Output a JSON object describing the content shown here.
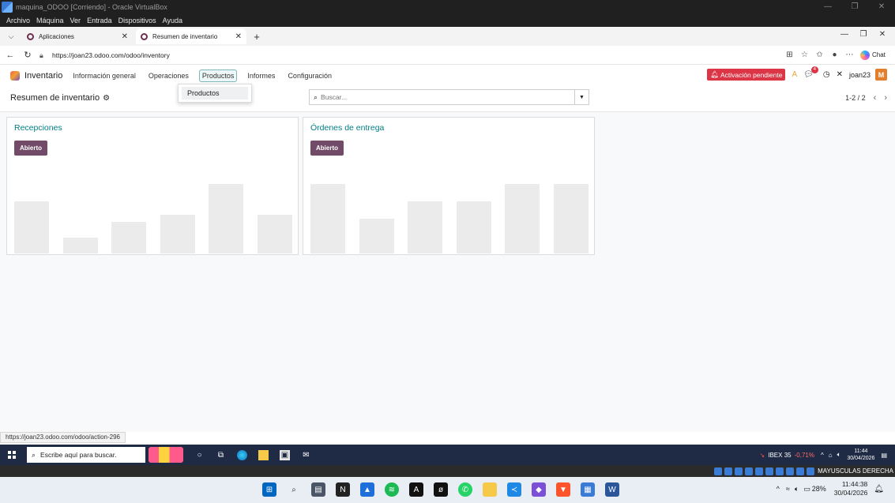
{
  "vbox": {
    "title": "maquina_ODOO [Corriendo] - Oracle VirtualBox",
    "menu": [
      "Archivo",
      "Máquina",
      "Ver",
      "Entrada",
      "Dispositivos",
      "Ayuda"
    ]
  },
  "browser": {
    "tabs": [
      {
        "label": "Aplicaciones",
        "active": false
      },
      {
        "label": "Resumen de inventario",
        "active": true
      }
    ],
    "url": "https://joan23.odoo.com/odoo/inventory",
    "chat_label": "Chat",
    "status_url": "https://joan23.odoo.com/odoo/action-296"
  },
  "odoo": {
    "app_name": "Inventario",
    "menu": [
      "Información general",
      "Operaciones",
      "Productos",
      "Informes",
      "Configuración"
    ],
    "active_menu": "Productos",
    "dropdown_items": [
      "Productos"
    ],
    "activation_badge": "Activación pendiente",
    "message_count": "4",
    "user_name": "joan23",
    "user_initial": "M",
    "breadcrumb": "Resumen de inventario",
    "search_placeholder": "Buscar...",
    "pager": "1-2 / 2"
  },
  "cards": [
    {
      "title": "Recepciones",
      "button": "Abierto",
      "bar_levels": [
        0.6,
        0.18,
        0.36,
        0.45,
        0.8,
        0.45
      ]
    },
    {
      "title": "Órdenes de entrega",
      "button": "Abierto",
      "bar_levels": [
        0.8,
        0.4,
        0.6,
        0.6,
        0.8,
        0.8
      ]
    }
  ],
  "vm_taskbar": {
    "search_placeholder": "Escribe aquí para buscar.",
    "ticker_name": "IBEX 35",
    "ticker_change": "-0,71%",
    "time": "11:44",
    "date": "30/04/2026"
  },
  "vb_status": {
    "host_key": "MAYUSCULAS DERECHA"
  },
  "host_taskbar": {
    "battery": "28%",
    "time": "11:44:38",
    "date": "30/04/2026"
  },
  "colors": {
    "odoo_primary": "#714b67",
    "odoo_teal": "#017e84",
    "danger": "#dc3545",
    "bar_placeholder": "#ebebeb"
  }
}
